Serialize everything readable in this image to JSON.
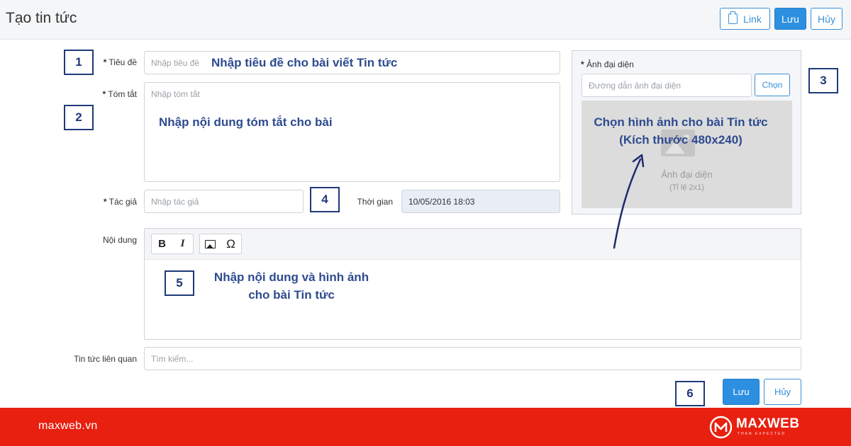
{
  "header": {
    "title": "Tạo tin tức",
    "link_label": "Link",
    "save_label": "Lưu",
    "cancel_label": "Hủy"
  },
  "form": {
    "title": {
      "label": "Tiêu đề",
      "placeholder": "Nhập tiêu đề"
    },
    "summary": {
      "label": "Tóm tắt",
      "placeholder": "Nhập tóm tắt"
    },
    "author": {
      "label": "Tác giả",
      "placeholder": "Nhập tác giả"
    },
    "time": {
      "label": "Thời gian",
      "value": "10/05/2016 18:03"
    },
    "content": {
      "label": "Nội dung"
    },
    "related": {
      "label": "Tin tức liên quan",
      "placeholder": "Tìm kiếm..."
    },
    "required_mark": "*"
  },
  "image_panel": {
    "label": "Ảnh đại diện",
    "path_placeholder": "Đường dẫn ảnh đại diện",
    "choose_label": "Chọn",
    "placeholder_caption": "Ảnh đại diện",
    "placeholder_ratio": "(Tỉ lệ 2x1)"
  },
  "toolbar": {
    "bold": "B",
    "italic": "I",
    "omega": "Ω"
  },
  "annotations": {
    "title_hint": "Nhập tiêu đề cho bài viết Tin tức",
    "summary_hint": "Nhập nội dung tóm tắt cho bài",
    "image_hint_line1": "Chọn hình ảnh cho bài Tin tức",
    "image_hint_line2": "(Kích thước 480x240)",
    "content_hint_line1": "Nhập nội dung và hình ảnh",
    "content_hint_line2": "cho bài Tin tức",
    "badges": [
      "1",
      "2",
      "3",
      "4",
      "5",
      "6"
    ]
  },
  "bottom_actions": {
    "save_label": "Lưu",
    "cancel_label": "Hủy"
  },
  "footer": {
    "site": "maxweb.vn",
    "logo_text": "MAXWEB",
    "logo_tagline": "THAN EXPECTED"
  },
  "colors": {
    "primary": "#2d8fe0",
    "annotation": "#1e3a78",
    "footer": "#e8200f"
  }
}
